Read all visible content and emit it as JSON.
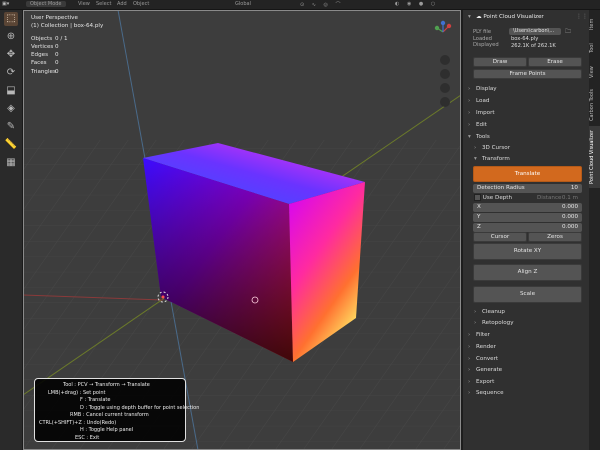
{
  "header": {
    "mode": "Object Mode",
    "menus": [
      "View",
      "Select",
      "Add",
      "Object"
    ],
    "transform_orientation": "Global"
  },
  "viewport": {
    "title": "User Perspective",
    "collection": "(1) Collection | box-64.ply",
    "stats": [
      {
        "label": "Objects",
        "value": "0 / 1"
      },
      {
        "label": "Vertices",
        "value": "0"
      },
      {
        "label": "Edges",
        "value": "0"
      },
      {
        "label": "Faces",
        "value": "0"
      },
      {
        "label": "Triangles",
        "value": "0"
      }
    ]
  },
  "panel": {
    "title": "Point Cloud Visualizer",
    "ply_file_label": "PLY file",
    "ply_file_value": "\\Users\\carbon\\...",
    "loaded_label": "Loaded",
    "loaded_value": "box-64.ply",
    "displayed_label": "Displayed",
    "displayed_value": "262.1K of 262.1K",
    "draw_label": "Draw",
    "erase_label": "Erase",
    "frame_points_label": "Frame Points",
    "sections_top": [
      "Display",
      "Load",
      "Import",
      "Edit",
      "Tools"
    ],
    "tools_sub": [
      "3D Cursor",
      "Transform"
    ],
    "translate_label": "Translate",
    "detection_radius_label": "Detection Radius",
    "detection_radius_value": "10",
    "use_depth_label": "Use Depth",
    "distance_label": "Distance",
    "distance_value": "0.1 m",
    "x_label": "X",
    "x_value": "0.000",
    "y_label": "Y",
    "y_value": "0.000",
    "z_label": "Z",
    "z_value": "0.000",
    "cursor_label": "Cursor",
    "zeros_label": "Zeros",
    "rotate_label": "Rotate XY",
    "align_label": "Align Z",
    "scale_label": "Scale",
    "sections_bottom": [
      "Cleanup",
      "Retopology",
      "Filter",
      "Render",
      "Convert",
      "Generate",
      "Export",
      "Sequence"
    ]
  },
  "tabs": [
    "Item",
    "Tool",
    "View",
    "Carbon Tools",
    "Point Cloud Visualizer"
  ],
  "help": {
    "lines": [
      "Tool : PCV → Transform → Translate",
      "LMB(+drag) : Set point",
      "F : Translate",
      "D : Toggle using depth buffer for point selection",
      "RMB : Cancel current transform",
      "CTRL(+SHIFT)+Z : Undo(Redo)",
      "H : Toggle Help panel",
      "ESC : Exit"
    ]
  },
  "colors": {
    "accent": "#d2691e",
    "panel_bg": "#303030",
    "viewport_bg": "#3d3d3d"
  }
}
